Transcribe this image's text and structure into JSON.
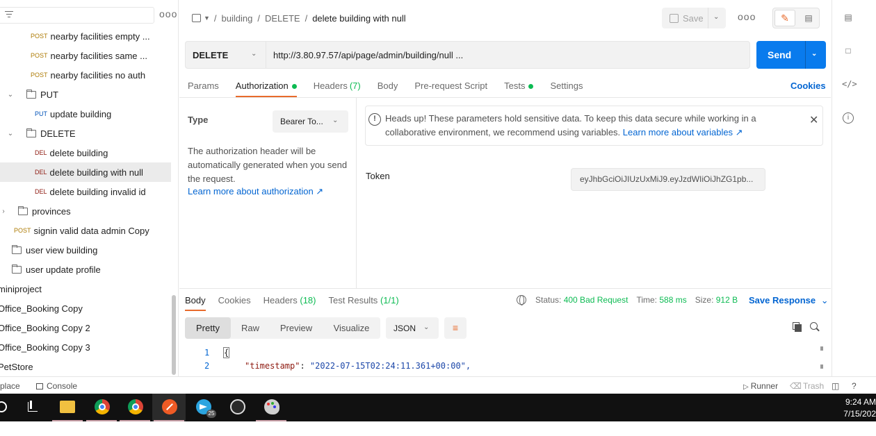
{
  "sidebar": {
    "items": [
      {
        "method": "POST",
        "label": "nearby facilities empty ..."
      },
      {
        "method": "POST",
        "label": "nearby facilities same ..."
      },
      {
        "method": "POST",
        "label": "nearby facilities no auth"
      },
      {
        "folder": true,
        "label": "PUT"
      },
      {
        "method": "PUT",
        "label": "update building"
      },
      {
        "folder": true,
        "label": "DELETE"
      },
      {
        "method": "DEL",
        "label": "delete building"
      },
      {
        "method": "DEL",
        "label": "delete building with null"
      },
      {
        "method": "DEL",
        "label": "delete building invalid id"
      },
      {
        "folder": true,
        "label": "provinces"
      },
      {
        "method": "POST",
        "label": "signin valid data admin Copy"
      },
      {
        "folder": true,
        "label": "user view building"
      },
      {
        "folder": true,
        "label": "user update profile"
      },
      {
        "label": "miniproject"
      },
      {
        "label": "Office_Booking Copy"
      },
      {
        "label": "Office_Booking Copy 2"
      },
      {
        "label": "Office_Booking Copy 3"
      },
      {
        "label": "PetStore"
      }
    ]
  },
  "breadcrumb": {
    "parts": [
      "building",
      "DELETE"
    ],
    "current": "delete building with null"
  },
  "header": {
    "save_label": "Save",
    "more": "ooo"
  },
  "request": {
    "method": "DELETE",
    "url": "http://3.80.97.57/api/page/admin/building/null ...",
    "send_label": "Send"
  },
  "tabs": {
    "params": "Params",
    "authorization": "Authorization",
    "headers": "Headers",
    "headers_count": "(7)",
    "body": "Body",
    "prerequest": "Pre-request Script",
    "tests": "Tests",
    "settings": "Settings",
    "cookies": "Cookies"
  },
  "auth": {
    "type_label": "Type",
    "type_value": "Bearer To...",
    "description": "The authorization header will be automatically generated when you send the request.",
    "learn_link": "Learn more about authorization ↗",
    "alert_text": "Heads up! These parameters hold sensitive data. To keep this data secure while working in a collaborative environment, we recommend using variables.",
    "alert_link": "Learn more about variables ↗",
    "token_label": "Token",
    "token_value": "eyJhbGciOiJIUzUxMiJ9.eyJzdWIiOiJhZG1pb..."
  },
  "response": {
    "tabs": {
      "body": "Body",
      "cookies": "Cookies",
      "headers": "Headers",
      "headers_count": "(18)",
      "test_results": "Test Results",
      "test_count": "(1/1)"
    },
    "status_label": "Status:",
    "status_value": "400 Bad Request",
    "time_label": "Time:",
    "time_value": "588 ms",
    "size_label": "Size:",
    "size_value": "912 B",
    "save_response": "Save Response",
    "formats": [
      "Pretty",
      "Raw",
      "Preview",
      "Visualize"
    ],
    "language": "JSON",
    "code": [
      {
        "line": "1",
        "text": "{"
      },
      {
        "line": "2",
        "key": "\"timestamp\"",
        "value": "\"2022-07-15T02:24:11.361+00:00\","
      }
    ]
  },
  "footer": {
    "left": "place",
    "console": "Console",
    "runner": "Runner",
    "trash": "Trash"
  },
  "taskbar": {
    "time": "9:24 AM",
    "date": "7/15/202",
    "telegram_badge": "25"
  },
  "colors": {
    "accent": "#e86b2c",
    "primary": "#097bed",
    "link": "#0265d2",
    "success": "#0cbb52"
  }
}
